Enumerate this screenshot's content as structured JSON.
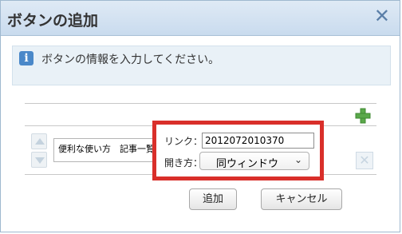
{
  "dialog": {
    "title": "ボタンの追加",
    "close_icon": "close-icon",
    "close_glyph": "✕"
  },
  "info": {
    "icon": "info-icon",
    "icon_glyph": "i",
    "message": "ボタンの情報を入力してください。"
  },
  "toolbar": {
    "add_row_icon": "plus-icon"
  },
  "row": {
    "name_value": "便利な使い方　記事一覧",
    "link_label": "リンク：",
    "link_value": "2012072010370",
    "open_label": "開き方：",
    "open_value": "同ウィンドウ",
    "chevron": "⌄",
    "delete_glyph": "✕"
  },
  "buttons": {
    "add_label": "追加",
    "cancel_label": "キャンセル"
  },
  "colors": {
    "highlight": "#d92f2a",
    "titlebar": "#c9dbee",
    "info_bg": "#e9f1f7",
    "plus_green": "#5aa84a"
  }
}
